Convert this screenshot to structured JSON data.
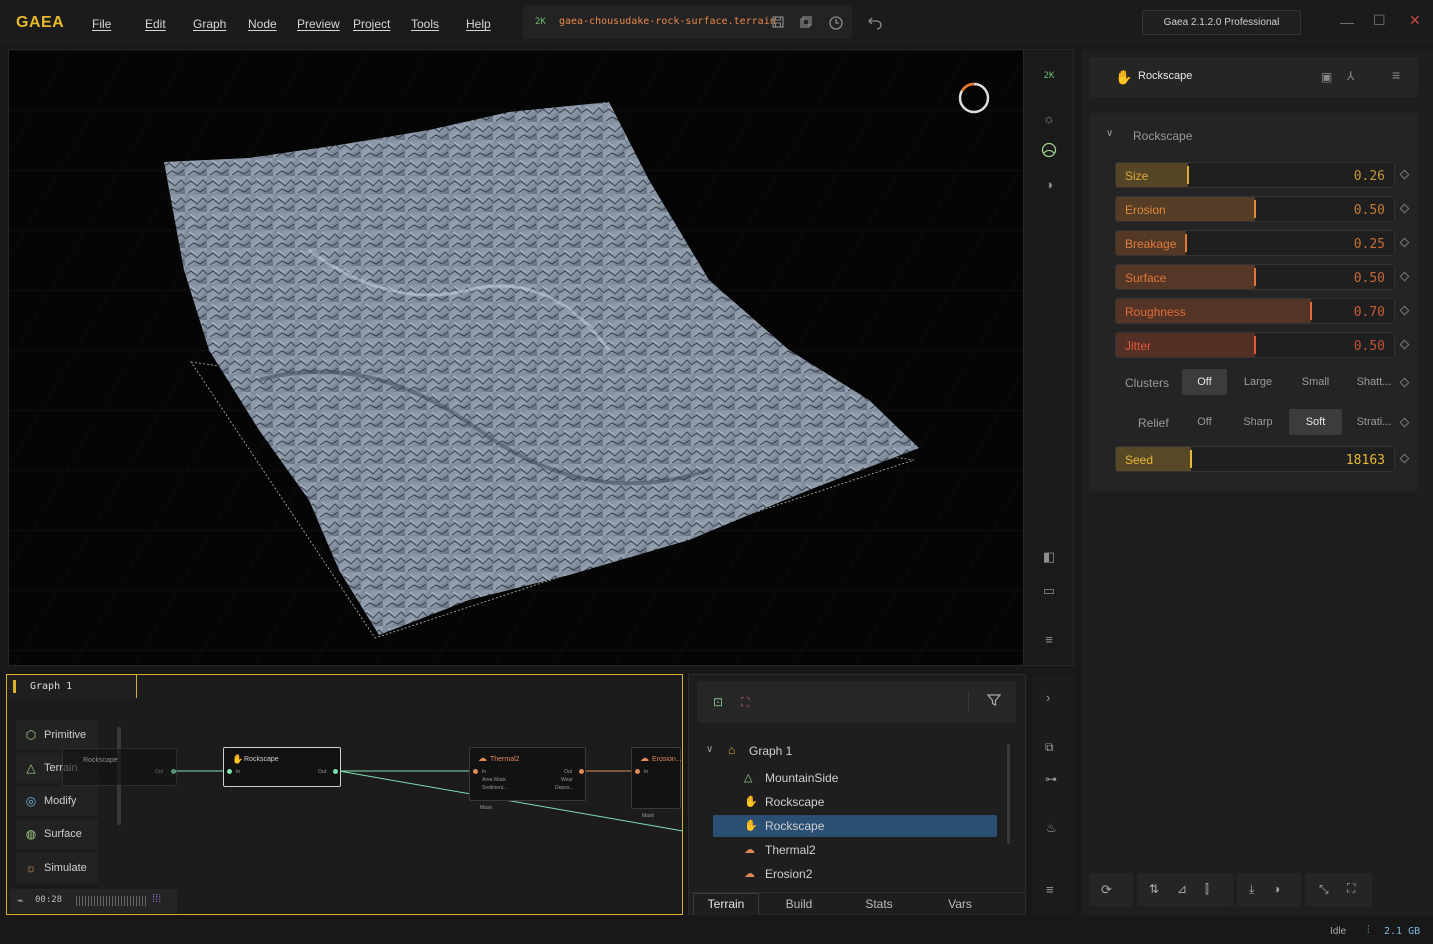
{
  "app": {
    "logo": "GAEA",
    "edition": "Gaea 2.1.2.0 Professional"
  },
  "menu": [
    "File",
    "Edit",
    "Graph",
    "Node",
    "Preview",
    "Project",
    "Tools",
    "Help"
  ],
  "file": {
    "resolution": "2K",
    "name": "gaea-chousudake-rock-surface.terrain"
  },
  "viewport": {
    "resolution_badge": "2K"
  },
  "properties": {
    "node_title": "Rockscape",
    "section": "Rockscape",
    "sliders": [
      {
        "label": "Size",
        "value": "0.26",
        "fraction": 0.26,
        "color": "#e0a93a"
      },
      {
        "label": "Erosion",
        "value": "0.50",
        "fraction": 0.5,
        "color": "#e08a3a"
      },
      {
        "label": "Breakage",
        "value": "0.25",
        "fraction": 0.25,
        "color": "#e07a3a"
      },
      {
        "label": "Surface",
        "value": "0.50",
        "fraction": 0.5,
        "color": "#e0763a"
      },
      {
        "label": "Roughness",
        "value": "0.70",
        "fraction": 0.7,
        "color": "#e06a3a"
      },
      {
        "label": "Jitter",
        "value": "0.50",
        "fraction": 0.5,
        "color": "#e05a3a"
      }
    ],
    "clusters": {
      "label": "Clusters",
      "options": [
        "Off",
        "Large",
        "Small",
        "Shatt..."
      ],
      "selected": "Off"
    },
    "relief": {
      "label": "Relief",
      "options": [
        "Off",
        "Sharp",
        "Soft",
        "Strati..."
      ],
      "selected": "Soft"
    },
    "seed": {
      "label": "Seed",
      "value": "18163",
      "fraction": 0.27,
      "color": "#e8b83a"
    }
  },
  "graph": {
    "tab": "Graph 1",
    "categories": [
      "Primitive",
      "Terrain",
      "Modify",
      "Surface",
      "Simulate"
    ],
    "timer": "00:28",
    "nodes": {
      "rockscape_a": {
        "title": "Rockscape",
        "out": "Out"
      },
      "rockscape_b": {
        "title": "Rockscape",
        "in": "In",
        "out": "Out"
      },
      "thermal": {
        "title": "Thermal2",
        "in": "In",
        "area": "Area Mask",
        "sediment": "Sediment...",
        "out": "Out",
        "wear": "Wear",
        "depo": "Depos...",
        "mask": "Mask"
      },
      "erosion": {
        "title": "Erosion...",
        "in": "In",
        "mask": "Mask"
      }
    }
  },
  "tree": {
    "root": "Graph 1",
    "items": [
      {
        "label": "MountainSide",
        "icon": "mountain-icon",
        "selected": false
      },
      {
        "label": "Rockscape",
        "icon": "hand-icon",
        "selected": false
      },
      {
        "label": "Rockscape",
        "icon": "hand-icon",
        "selected": true
      },
      {
        "label": "Thermal2",
        "icon": "cloud-icon",
        "selected": false
      },
      {
        "label": "Erosion2",
        "icon": "cloud-icon",
        "selected": false
      }
    ],
    "tabs": [
      "Terrain",
      "Build",
      "Stats",
      "Vars"
    ],
    "active_tab": "Terrain"
  },
  "status": {
    "state": "Idle",
    "memory": "2.1 GB"
  },
  "colors": {
    "accent": "#e8b82a",
    "selection": "#2b4f73",
    "node_green": "#7fe0b0"
  }
}
